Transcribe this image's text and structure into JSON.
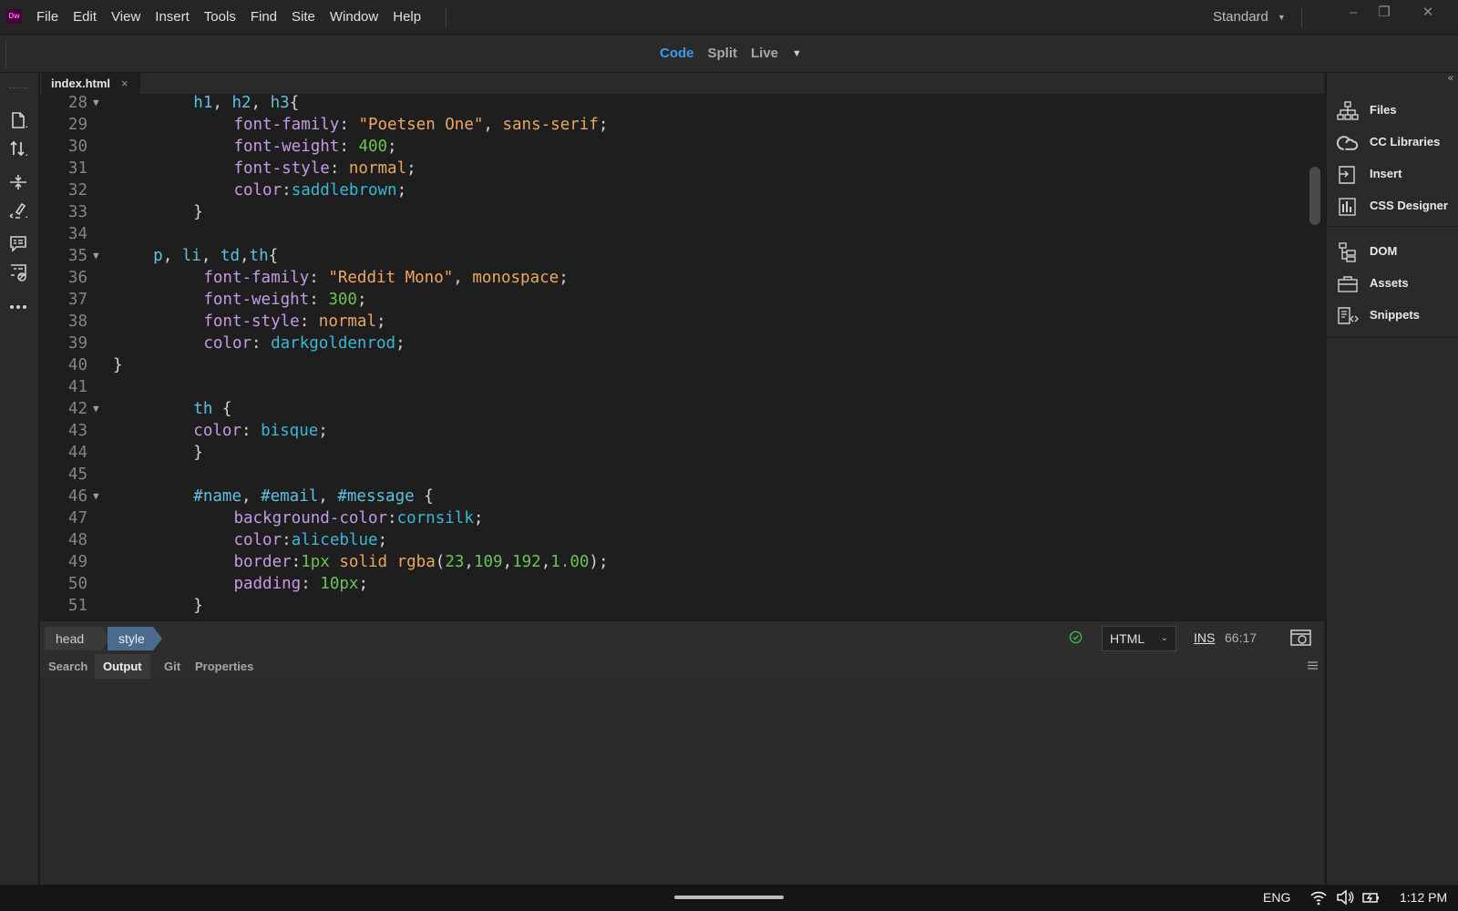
{
  "app": {
    "logo": "Dw"
  },
  "menu": [
    "File",
    "Edit",
    "View",
    "Insert",
    "Tools",
    "Find",
    "Site",
    "Window",
    "Help"
  ],
  "workspace": {
    "label": "Standard"
  },
  "window_controls": {
    "minimize": "–",
    "restore": "❐",
    "close": "✕"
  },
  "views": {
    "code": "Code",
    "split": "Split",
    "live": "Live",
    "active": "Code"
  },
  "document_tab": {
    "name": "index.html",
    "close": "×"
  },
  "code_lines": [
    {
      "n": "28",
      "fold": true,
      "indent": 4,
      "tokens": [
        [
          "sel",
          "h1"
        ],
        [
          "p",
          ", "
        ],
        [
          "sel",
          "h2"
        ],
        [
          "p",
          ", "
        ],
        [
          "sel",
          "h3"
        ],
        [
          "p",
          "{"
        ]
      ]
    },
    {
      "n": "29",
      "fold": false,
      "indent": 6,
      "tokens": [
        [
          "prop",
          "font-family"
        ],
        [
          "p",
          ": "
        ],
        [
          "str",
          "\"Poetsen One\""
        ],
        [
          "p",
          ", "
        ],
        [
          "kw",
          "sans-serif"
        ],
        [
          "p",
          ";"
        ]
      ]
    },
    {
      "n": "30",
      "fold": false,
      "indent": 6,
      "tokens": [
        [
          "prop",
          "font-weight"
        ],
        [
          "p",
          ": "
        ],
        [
          "num",
          "400"
        ],
        [
          "p",
          ";"
        ]
      ]
    },
    {
      "n": "31",
      "fold": false,
      "indent": 6,
      "tokens": [
        [
          "prop",
          "font-style"
        ],
        [
          "p",
          ": "
        ],
        [
          "kw",
          "normal"
        ],
        [
          "p",
          ";"
        ]
      ]
    },
    {
      "n": "32",
      "fold": false,
      "indent": 6,
      "tokens": [
        [
          "prop",
          "color"
        ],
        [
          "p",
          ":"
        ],
        [
          "col",
          "saddlebrown"
        ],
        [
          "p",
          ";"
        ]
      ]
    },
    {
      "n": "33",
      "fold": false,
      "indent": 4,
      "tokens": [
        [
          "p",
          "}"
        ]
      ]
    },
    {
      "n": "34",
      "fold": false,
      "indent": 0,
      "tokens": []
    },
    {
      "n": "35",
      "fold": true,
      "indent": 2,
      "tokens": [
        [
          "sel",
          "p"
        ],
        [
          "p",
          ", "
        ],
        [
          "sel",
          "li"
        ],
        [
          "p",
          ", "
        ],
        [
          "sel",
          "td"
        ],
        [
          "p",
          ","
        ],
        [
          "sel",
          "th"
        ],
        [
          "p",
          "{"
        ]
      ]
    },
    {
      "n": "36",
      "fold": false,
      "indent": 4.5,
      "tokens": [
        [
          "prop",
          "font-family"
        ],
        [
          "p",
          ": "
        ],
        [
          "str",
          "\"Reddit Mono\""
        ],
        [
          "p",
          ", "
        ],
        [
          "kw",
          "monospace"
        ],
        [
          "p",
          ";"
        ]
      ]
    },
    {
      "n": "37",
      "fold": false,
      "indent": 4.5,
      "tokens": [
        [
          "prop",
          "font-weight"
        ],
        [
          "p",
          ": "
        ],
        [
          "num",
          "300"
        ],
        [
          "p",
          ";"
        ]
      ]
    },
    {
      "n": "38",
      "fold": false,
      "indent": 4.5,
      "tokens": [
        [
          "prop",
          "font-style"
        ],
        [
          "p",
          ": "
        ],
        [
          "kw",
          "normal"
        ],
        [
          "p",
          ";"
        ]
      ]
    },
    {
      "n": "39",
      "fold": false,
      "indent": 4.5,
      "tokens": [
        [
          "prop",
          "color"
        ],
        [
          "p",
          ": "
        ],
        [
          "col",
          "darkgoldenrod"
        ],
        [
          "p",
          ";"
        ]
      ]
    },
    {
      "n": "40",
      "fold": false,
      "indent": 0,
      "tokens": [
        [
          "p",
          "}"
        ]
      ]
    },
    {
      "n": "41",
      "fold": false,
      "indent": 0,
      "tokens": []
    },
    {
      "n": "42",
      "fold": true,
      "indent": 4,
      "tokens": [
        [
          "sel",
          "th"
        ],
        [
          "p",
          " {"
        ]
      ]
    },
    {
      "n": "43",
      "fold": false,
      "indent": 4,
      "tokens": [
        [
          "prop",
          "color"
        ],
        [
          "p",
          ": "
        ],
        [
          "col",
          "bisque"
        ],
        [
          "p",
          ";"
        ]
      ]
    },
    {
      "n": "44",
      "fold": false,
      "indent": 4,
      "tokens": [
        [
          "p",
          "}"
        ]
      ]
    },
    {
      "n": "45",
      "fold": false,
      "indent": 0,
      "tokens": []
    },
    {
      "n": "46",
      "fold": true,
      "indent": 4,
      "tokens": [
        [
          "sel",
          "#name"
        ],
        [
          "p",
          ", "
        ],
        [
          "sel",
          "#email"
        ],
        [
          "p",
          ", "
        ],
        [
          "sel",
          "#message"
        ],
        [
          "p",
          " {"
        ]
      ]
    },
    {
      "n": "47",
      "fold": false,
      "indent": 6,
      "tokens": [
        [
          "prop",
          "background-color"
        ],
        [
          "p",
          ":"
        ],
        [
          "col",
          "cornsilk"
        ],
        [
          "p",
          ";"
        ]
      ]
    },
    {
      "n": "48",
      "fold": false,
      "indent": 6,
      "tokens": [
        [
          "prop",
          "color"
        ],
        [
          "p",
          ":"
        ],
        [
          "col",
          "aliceblue"
        ],
        [
          "p",
          ";"
        ]
      ]
    },
    {
      "n": "49",
      "fold": false,
      "indent": 6,
      "tokens": [
        [
          "prop",
          "border"
        ],
        [
          "p",
          ":"
        ],
        [
          "num",
          "1px"
        ],
        [
          "p",
          " "
        ],
        [
          "kw",
          "solid"
        ],
        [
          "p",
          " "
        ],
        [
          "kw",
          "rgba"
        ],
        [
          "p",
          "("
        ],
        [
          "num",
          "23"
        ],
        [
          "p",
          ","
        ],
        [
          "num",
          "109"
        ],
        [
          "p",
          ","
        ],
        [
          "num",
          "192"
        ],
        [
          "p",
          ","
        ],
        [
          "num",
          "1.00"
        ],
        [
          "p",
          ");"
        ]
      ]
    },
    {
      "n": "50",
      "fold": false,
      "indent": 6,
      "tokens": [
        [
          "prop",
          "padding"
        ],
        [
          "p",
          ": "
        ],
        [
          "num",
          "10px"
        ],
        [
          "p",
          ";"
        ]
      ]
    },
    {
      "n": "51",
      "fold": false,
      "indent": 4,
      "tokens": [
        [
          "p",
          "}"
        ]
      ]
    }
  ],
  "status": {
    "crumbs": [
      "head",
      "style"
    ],
    "language": "HTML",
    "mode": "INS",
    "cursor": "66:17"
  },
  "panel_tabs": [
    "Search",
    "Output",
    "Git",
    "Properties"
  ],
  "panel_active": "Output",
  "right_panels": [
    "Files",
    "CC Libraries",
    "Insert",
    "CSS Designer",
    "DOM",
    "Assets",
    "Snippets"
  ],
  "taskbar": {
    "lang": "ENG",
    "time": "1:12 PM"
  },
  "colors": {
    "accent": "#3a9bf0",
    "crumb_active": "#4a6a8e",
    "ok": "#3fb950"
  }
}
